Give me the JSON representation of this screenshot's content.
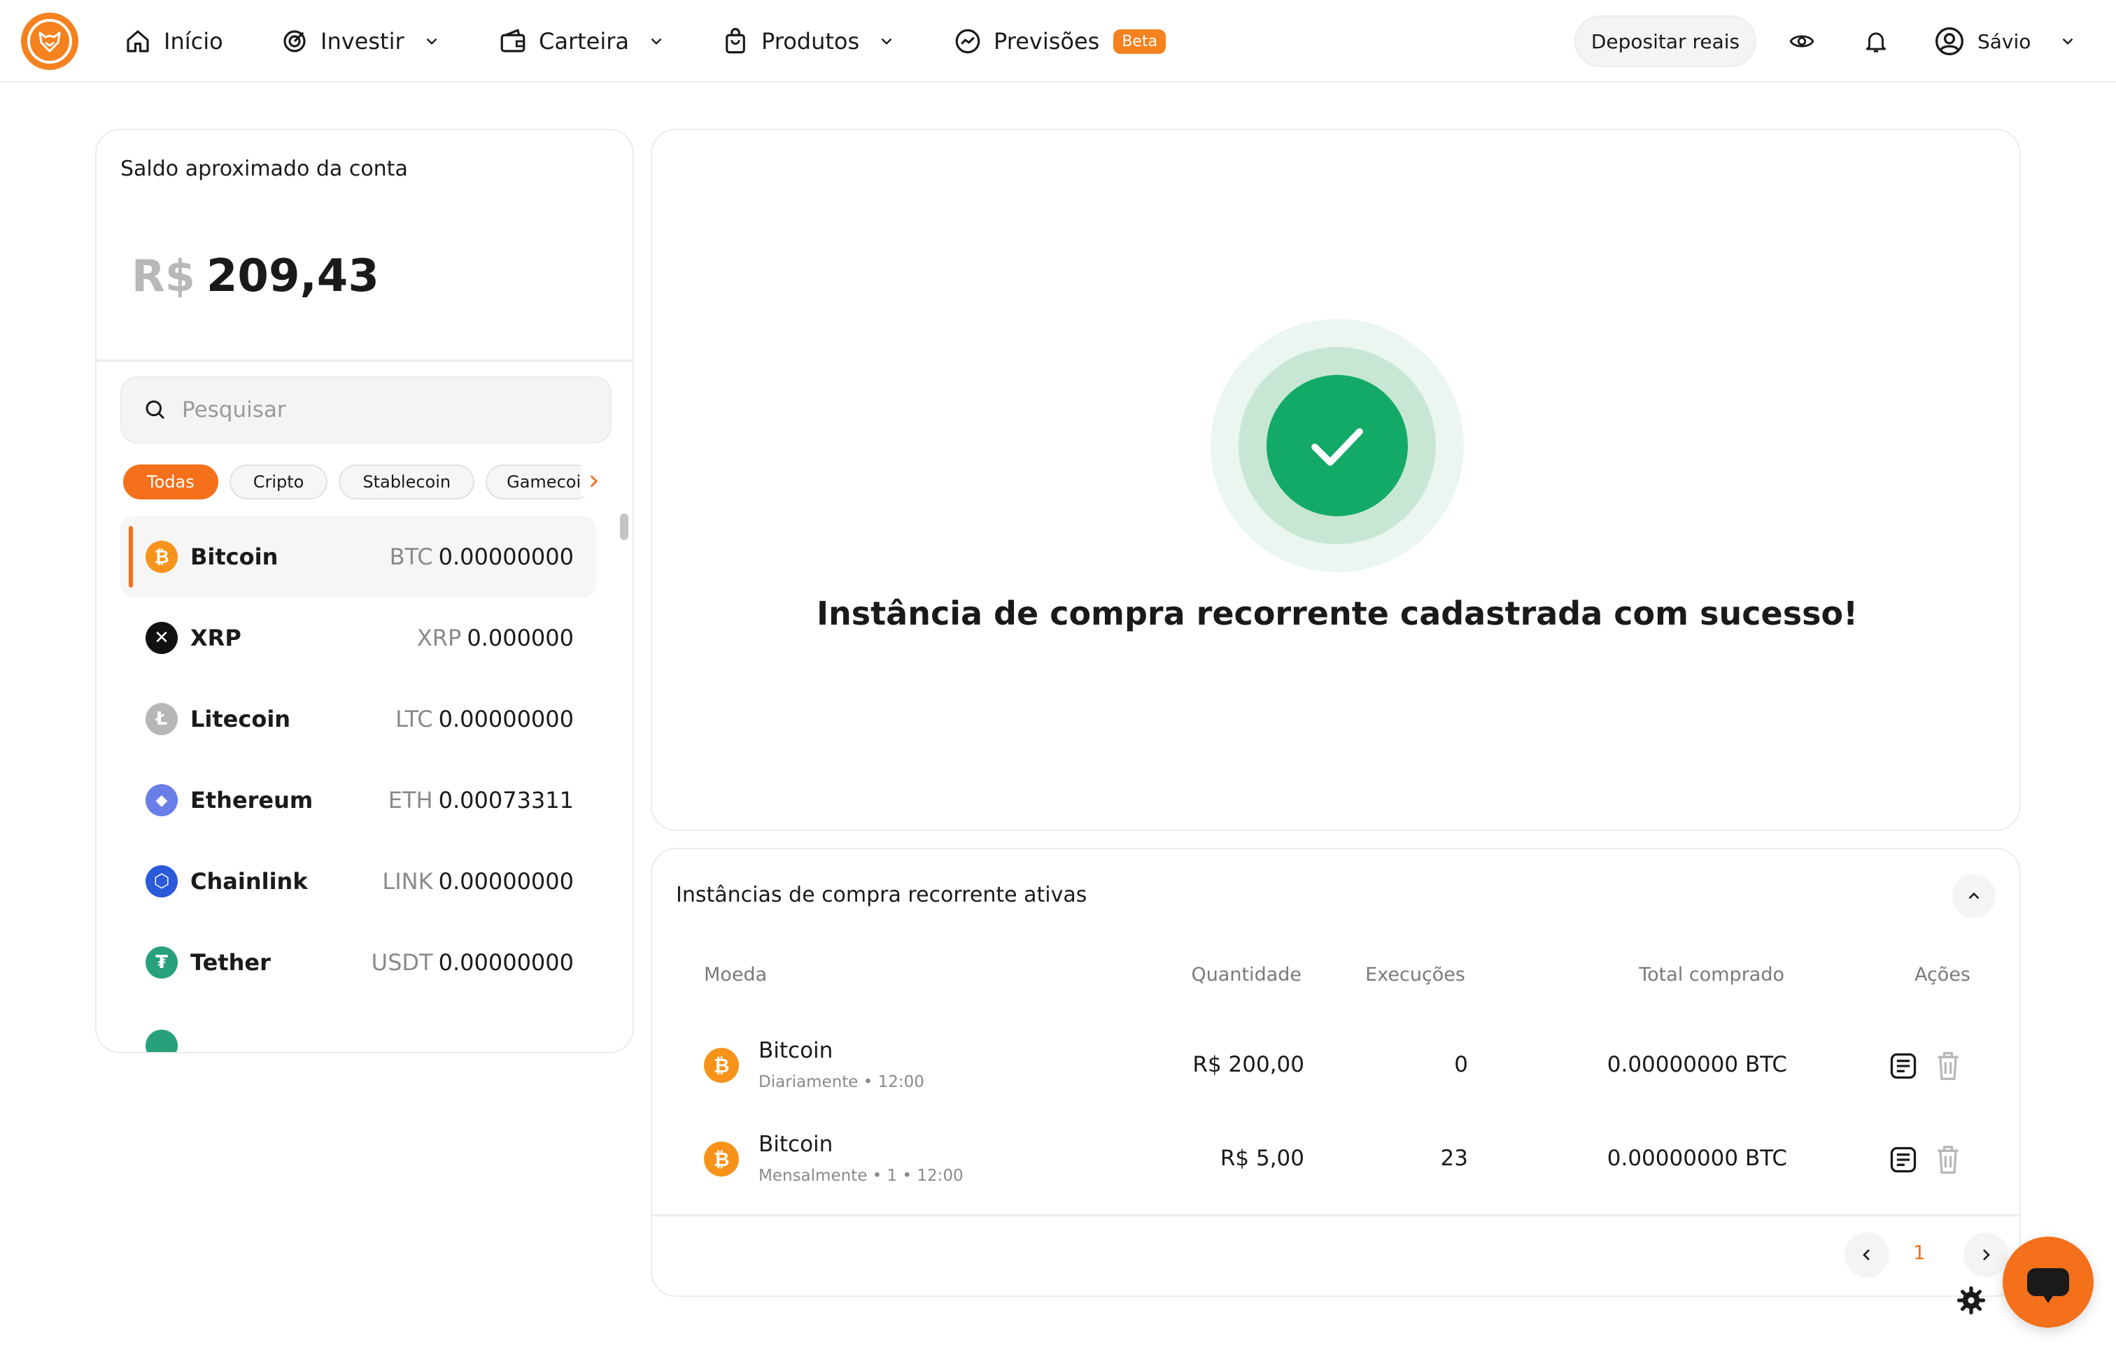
{
  "nav": {
    "items": [
      {
        "label": "Início",
        "icon": "home-icon"
      },
      {
        "label": "Investir",
        "icon": "target-icon"
      },
      {
        "label": "Carteira",
        "icon": "wallet-icon"
      },
      {
        "label": "Produtos",
        "icon": "bag-icon"
      },
      {
        "label": "Previsões",
        "icon": "trend-icon",
        "badge": "Beta"
      }
    ],
    "deposit_label": "Depositar reais",
    "user_name": "Sávio"
  },
  "account": {
    "title": "Saldo aproximado da conta",
    "currency": "R$",
    "balance": "209,43"
  },
  "search": {
    "placeholder": "Pesquisar"
  },
  "filters": [
    "Todas",
    "Cripto",
    "Stablecoin",
    "Gamecoins"
  ],
  "coins": [
    {
      "name": "Bitcoin",
      "symbol": "BTC",
      "balance": "0.00000000",
      "color": "#f7931a",
      "glyph": "₿"
    },
    {
      "name": "XRP",
      "symbol": "XRP",
      "balance": "0.000000",
      "color": "#111111",
      "glyph": "✕"
    },
    {
      "name": "Litecoin",
      "symbol": "LTC",
      "balance": "0.00000000",
      "color": "#b6b6b6",
      "glyph": "Ł"
    },
    {
      "name": "Ethereum",
      "symbol": "ETH",
      "balance": "0.00073311",
      "color": "#6a7ee8",
      "glyph": "◆"
    },
    {
      "name": "Chainlink",
      "symbol": "LINK",
      "balance": "0.00000000",
      "color": "#2a5ada",
      "glyph": "⬡"
    },
    {
      "name": "Tether",
      "symbol": "USDT",
      "balance": "0.00000000",
      "color": "#26a17b",
      "glyph": "₮"
    }
  ],
  "success": {
    "message": "Instância de compra recorrente cadastrada com sucesso!"
  },
  "instances": {
    "title": "Instâncias de compra recorrente ativas",
    "headers": {
      "coin": "Moeda",
      "quantity": "Quantidade",
      "executions": "Execuções",
      "total": "Total comprado",
      "actions": "Ações"
    },
    "rows": [
      {
        "coin": "Bitcoin",
        "schedule": "Diariamente • 12:00",
        "quantity": "R$ 200,00",
        "executions": "0",
        "total": "0.00000000 BTC"
      },
      {
        "coin": "Bitcoin",
        "schedule": "Mensalmente • 1 • 12:00",
        "quantity": "R$ 5,00",
        "executions": "23",
        "total": "0.00000000 BTC"
      }
    ],
    "page": "1"
  },
  "colors": {
    "accent": "#f5701a",
    "success": "#13aa68",
    "bitcoin": "#f7931a"
  }
}
